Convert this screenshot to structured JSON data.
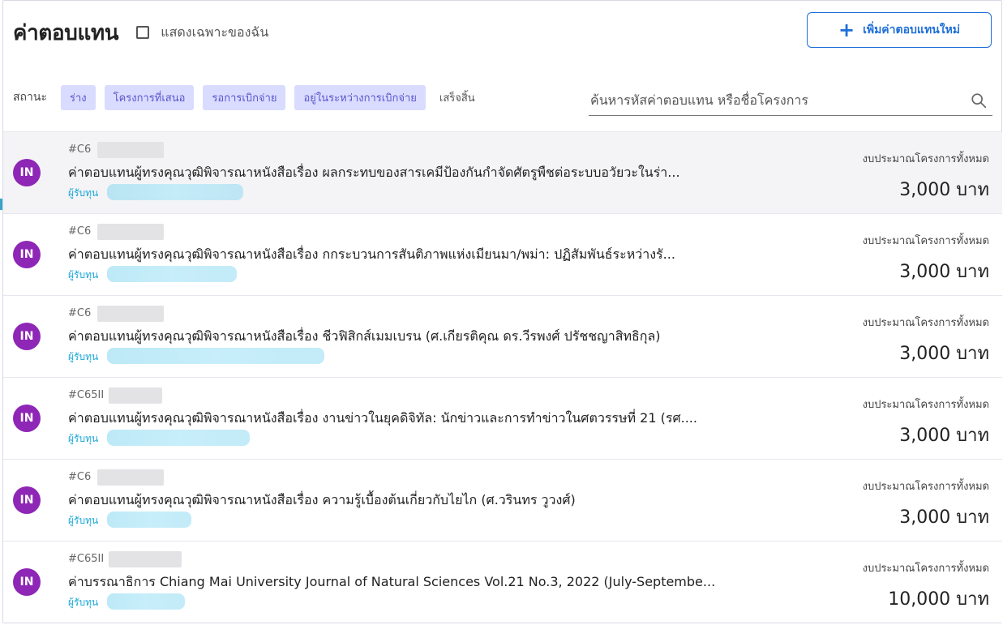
{
  "header": {
    "title": "ค่าตอบแทน",
    "only_mine_label": "แสดงเฉพาะของฉัน",
    "add_button_label": "เพิ่มค่าตอบแทนใหม่"
  },
  "filters": {
    "label": "สถานะ",
    "chips": [
      "ร่าง",
      "โครงการที่เสนอ",
      "รอการเบิกจ่าย",
      "อยู่ในระหว่างการเบิกจ่าย"
    ],
    "done_label": "เสร็จสิ้น"
  },
  "search": {
    "placeholder": "ค้นหารหัสค่าตอบแทน หรือชื่อโครงการ"
  },
  "rows": [
    {
      "avatar": "IN",
      "code": "#C6",
      "title": "ค่าตอบแทนผู้ทรงคุณวุฒิพิจารณาหนังสือเรื่อง ผลกระทบของสารเคมีป้องกันกำจัดศัตรูพืชต่อระบบอวัยวะในร่า...",
      "funder_label": "ผู้รับทุน",
      "budget_label": "งบประมาณโครงการทั้งหมด",
      "amount": "3,000 บาท"
    },
    {
      "avatar": "IN",
      "code": "#C6",
      "title": "ค่าตอบแทนผู้ทรงคุณวุฒิพิจารณาหนังสือเรื่อง กกระบวนการสันติภาพแห่งเมียนมา/พม่า: ปฏิสัมพันธ์ระหว่างรั...",
      "funder_label": "ผู้รับทุน",
      "budget_label": "งบประมาณโครงการทั้งหมด",
      "amount": "3,000 บาท"
    },
    {
      "avatar": "IN",
      "code": "#C6",
      "title": "ค่าตอบแทนผู้ทรงคุณวุฒิพิจารณาหนังสือเรื่อง ชีวฟิสิกส์เมมเบรน (ศ.เกียรติคุณ ดร.วีรพงศ์ ปรัชชญาสิทธิกุล)",
      "funder_label": "ผู้รับทุน",
      "budget_label": "งบประมาณโครงการทั้งหมด",
      "amount": "3,000 บาท"
    },
    {
      "avatar": "IN",
      "code": "#C65II",
      "title": "ค่าตอบแทนผู้ทรงคุณวุฒิพิจารณาหนังสือเรื่อง งานข่าวในยุคดิจิทัล: นักข่าวและการทำข่าวในศตวรรษที่ 21 (รศ....",
      "funder_label": "ผู้รับทุน",
      "budget_label": "งบประมาณโครงการทั้งหมด",
      "amount": "3,000 บาท"
    },
    {
      "avatar": "IN",
      "code": "#C6",
      "title": "ค่าตอบแทนผู้ทรงคุณวุฒิพิจารณาหนังสือเรื่อง ความรู้เบื้องต้นเกี่ยวกับไยไก (ศ.วรินทร วูวงศ์)",
      "funder_label": "ผู้รับทุน",
      "budget_label": "งบประมาณโครงการทั้งหมด",
      "amount": "3,000 บาท"
    },
    {
      "avatar": "IN",
      "code": "#C65II",
      "title": "ค่าบรรณาธิการ Chiang Mai University Journal of Natural Sciences Vol.21 No.3, 2022 (July-Septembe...",
      "funder_label": "ผู้รับทุน",
      "budget_label": "งบประมาณโครงการทั้งหมด",
      "amount": "10,000 บาท"
    }
  ],
  "colors": {
    "accent": "#1e6fd9",
    "chip_bg": "#d9dcff",
    "chip_text": "#5a55cc",
    "avatar_bg": "#8e26b6",
    "funder_text": "#1aa8d8"
  },
  "icons": {
    "add": "plus-icon",
    "search": "search-icon",
    "checkbox": "checkbox-icon"
  }
}
